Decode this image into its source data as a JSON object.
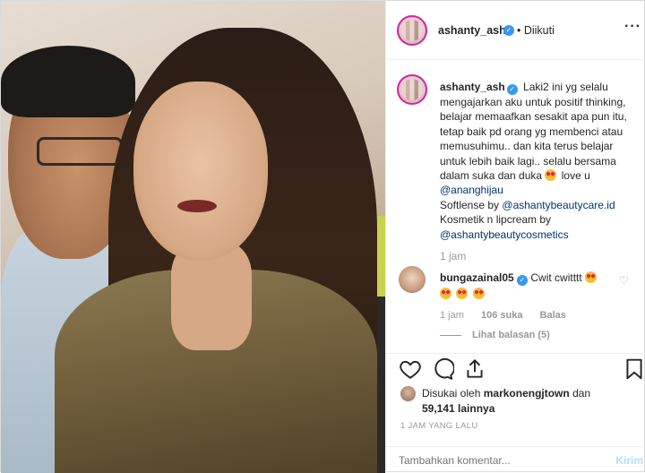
{
  "post": {
    "username": "ashanty_ash",
    "follow_status": "• Diikuti",
    "more_icon": "more-dots-icon"
  },
  "caption": {
    "username": "ashanty_ash",
    "text_1": "Laki2 ini yg selalu mengajarkan aku untuk positif thinking, belajar memaafkan sesakit apa pun itu, tetap baik pd orang yg membenci atau memusuhimu.. dan kita terus belajar untuk lebih baik lagi.. selalu bersama dalam suka dan duka",
    "text_2": "love u",
    "mention_1": "@ananghijau",
    "text_3": "Softlense by",
    "mention_2": "@ashantybeautycare.id",
    "text_4": "Kosmetik n lipcream by",
    "mention_3": "@ashantybeautycosmetics",
    "time": "1 jam"
  },
  "comment": {
    "username": "bungazainal05",
    "text": "Cwit cwitttt",
    "time": "1 jam",
    "likes": "106 suka",
    "reply": "Balas",
    "view_replies": "Lihat balasan (5)"
  },
  "likes": {
    "prefix": "Disukai oleh",
    "user": "markonengjtown",
    "joiner": "dan",
    "count": "59,141 lainnya"
  },
  "posted_ago": "1 JAM YANG LALU",
  "add_comment": {
    "placeholder": "Tambahkan komentar...",
    "post_label": "Kirim"
  },
  "colors": {
    "verified": "#3897f0",
    "link": "#003569",
    "muted": "#999999",
    "post_disabled": "#b2dffc"
  }
}
